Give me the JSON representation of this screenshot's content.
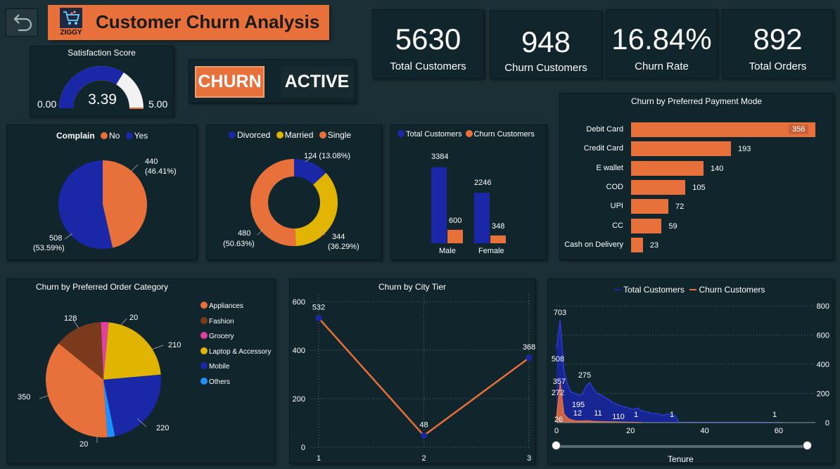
{
  "colors": {
    "bg": "#1b3036",
    "panel": "#11262c",
    "orange": "#e8703a",
    "blue": "#1a27a6",
    "yellow": "#e0b400",
    "brown": "#7b3a1c",
    "pink": "#e040a0",
    "lightblue": "#1e90ff"
  },
  "header": {
    "back_icon": "back-arrow-icon",
    "logo_text": "ZIGGY",
    "logo_icon": "shopping-cart-icon",
    "title": "Customer Churn Analysis"
  },
  "kpis": [
    {
      "value": "5630",
      "label": "Total Customers"
    },
    {
      "value": "948",
      "label": "Churn Customers"
    },
    {
      "value": "16.84%",
      "label": "Churn Rate"
    },
    {
      "value": "892",
      "label": "Total Orders"
    }
  ],
  "satisfaction": {
    "title": "Satisfaction Score",
    "value": 3.39,
    "value_text": "3.39",
    "min_text": "0.00",
    "max_text": "5.00"
  },
  "toggle": {
    "churn_label": "CHURN",
    "active_label": "ACTIVE"
  },
  "complain": {
    "title": "Complain",
    "legend": [
      "No",
      "Yes"
    ],
    "label_no": "440",
    "label_no_pct": "(46.41%)",
    "label_yes": "508",
    "label_yes_pct": "(53.59%)"
  },
  "marital": {
    "legend": [
      "Divorced",
      "Married",
      "Single"
    ],
    "label_div": "124 (13.08%)",
    "label_mar": "344",
    "label_mar_pct": "(36.29%)",
    "label_sin": "480",
    "label_sin_pct": "(50.63%)"
  },
  "gender": {
    "legend": [
      "Total Customers",
      "Churn Customers"
    ],
    "categories": [
      "Male",
      "Female"
    ],
    "total_labels": [
      "3384",
      "2246"
    ],
    "churn_labels": [
      "600",
      "348"
    ]
  },
  "payment": {
    "title": "Churn by Preferred Payment Mode"
  },
  "category": {
    "title": "Churn by Preferred Order Category",
    "legend": [
      "Appliances",
      "Fashion",
      "Grocery",
      "Laptop & Accessory",
      "Mobile",
      "Others"
    ],
    "lbl_350": "350",
    "lbl_128": "128",
    "lbl_20a": "20",
    "lbl_210": "210",
    "lbl_220": "220",
    "lbl_20b": "20"
  },
  "city": {
    "title": "Churn by City Tier"
  },
  "tenure": {
    "legend": [
      "Total Customers",
      "Churn Customers"
    ],
    "xlabel": "Tenure"
  },
  "chart_data": [
    {
      "type": "pie",
      "title": "Complain",
      "categories": [
        "No",
        "Yes"
      ],
      "values": [
        440,
        508
      ]
    },
    {
      "type": "pie",
      "title": "",
      "categories": [
        "Divorced",
        "Married",
        "Single"
      ],
      "values": [
        124,
        344,
        480
      ]
    },
    {
      "type": "bar",
      "categories": [
        "Male",
        "Female"
      ],
      "series": [
        {
          "name": "Total Customers",
          "values": [
            3384,
            2246
          ]
        },
        {
          "name": "Churn Customers",
          "values": [
            600,
            348
          ]
        }
      ],
      "ylim": [
        0,
        3600
      ]
    },
    {
      "type": "bar",
      "title": "Churn by Preferred Payment Mode",
      "categories": [
        "Debit Card",
        "Credit Card",
        "E wallet",
        "COD",
        "UPI",
        "CC",
        "Cash on Delivery"
      ],
      "values": [
        356,
        193,
        140,
        105,
        72,
        59,
        23
      ],
      "value_labels": [
        "356",
        "193",
        "140",
        "105",
        "72",
        "59",
        "23"
      ],
      "ylim": [
        0,
        356
      ]
    },
    {
      "type": "pie",
      "title": "Churn by Preferred Order Category",
      "categories": [
        "Appliances",
        "Fashion",
        "Grocery",
        "Laptop & Accessory",
        "Mobile",
        "Others"
      ],
      "values": [
        350,
        128,
        20,
        210,
        220,
        20
      ]
    },
    {
      "type": "line",
      "title": "Churn by City Tier",
      "x": [
        1,
        2,
        3
      ],
      "values": [
        532,
        48,
        368
      ],
      "value_labels": [
        "532",
        "48",
        "368"
      ],
      "x_ticks": [
        "1",
        "2",
        "3"
      ],
      "y_ticks": [
        "0",
        "200",
        "400",
        "600"
      ],
      "ylim": [
        0,
        600
      ]
    },
    {
      "type": "area",
      "xlabel": "Tenure",
      "series": [
        {
          "name": "Total Customers"
        },
        {
          "name": "Churn Customers"
        }
      ],
      "annotations": [
        "703",
        "508",
        "357",
        "272",
        "26",
        "275",
        "195",
        "12",
        "11",
        "110",
        "1",
        "1",
        "1"
      ],
      "x_ticks": [
        "0",
        "20",
        "40",
        "60"
      ],
      "y_ticks": [
        "0",
        "200",
        "400",
        "600",
        "800"
      ],
      "xlim": [
        0,
        68
      ],
      "ylim": [
        0,
        800
      ]
    }
  ]
}
